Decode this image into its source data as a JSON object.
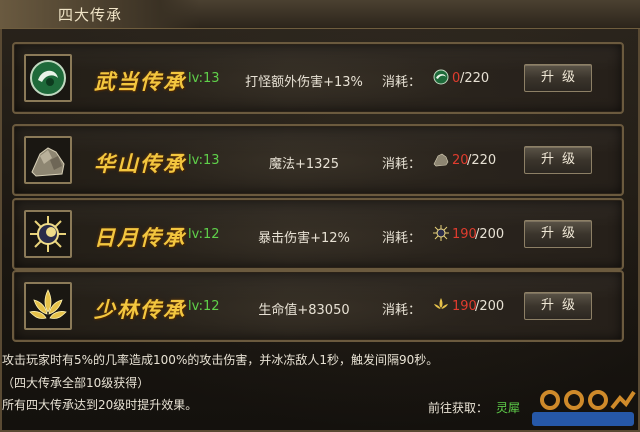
{
  "window": {
    "title": "四大传承"
  },
  "colors": {
    "name": "#f3c63f",
    "level": "#5fd04a",
    "cost_short": "#e03c2e",
    "accent_border": "#6b5a3e"
  },
  "rows": [
    {
      "icon": "jade-orb-icon",
      "name": "武当传承",
      "level": "lv:13",
      "effect": "打怪额外伤害+13%",
      "cost_label": "消耗：",
      "cost_icon": "jade-orb-icon",
      "cost_current": "0",
      "cost_total": "/220",
      "button": "升级"
    },
    {
      "icon": "rock-icon",
      "name": "华山传承",
      "level": "lv:13",
      "effect": "魔法+1325",
      "cost_label": "消耗：",
      "cost_icon": "rock-icon",
      "cost_current": "20",
      "cost_total": "/220",
      "button": "升级"
    },
    {
      "icon": "sun-moon-icon",
      "name": "日月传承",
      "level": "lv:12",
      "effect": "暴击伤害+12%",
      "cost_label": "消耗：",
      "cost_icon": "sun-moon-icon",
      "cost_current": "190",
      "cost_total": "/200",
      "button": "升级"
    },
    {
      "icon": "lotus-icon",
      "name": "少林传承",
      "level": "lv:12",
      "effect": "生命值+83050",
      "cost_label": "消耗：",
      "cost_icon": "lotus-icon",
      "cost_current": "190",
      "cost_total": "/200",
      "button": "升级"
    }
  ],
  "description": {
    "line1": "攻击玩家时有5%的几率造成100%的攻击伤害，并冰冻敌人1秒，触发间隔90秒。",
    "line2": "（四大传承全部10级获得）",
    "line3": "所有四大传承达到20级时提升效果。"
  },
  "footer": {
    "goto_label": "前往获取：",
    "goto_link": "灵犀"
  }
}
